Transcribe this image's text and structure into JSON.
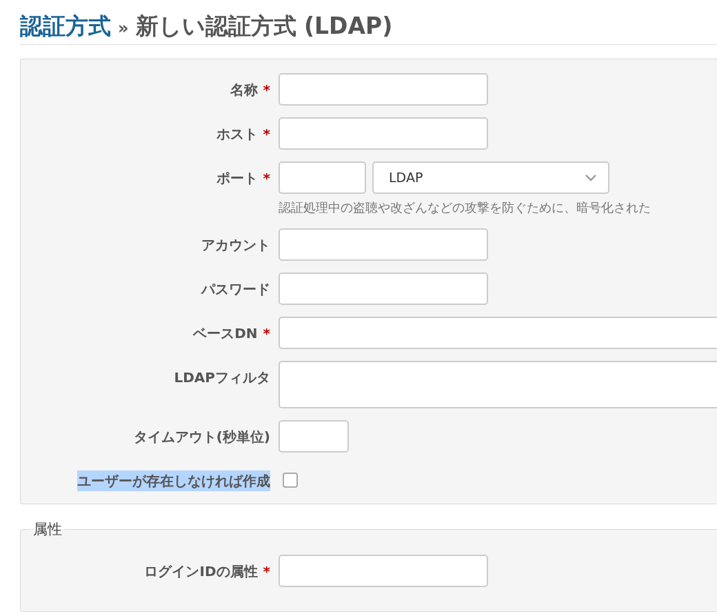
{
  "breadcrumb": {
    "parent": "認証方式",
    "separator": "»",
    "title": "新しい認証方式 (LDAP)"
  },
  "main_fields": [
    {
      "label": "名称",
      "required_mark": "*",
      "kind": "text",
      "highlighted": false
    },
    {
      "label": "ホスト",
      "required_mark": "*",
      "kind": "text",
      "highlighted": false
    },
    {
      "label": "ポート",
      "required_mark": "*",
      "kind": "port",
      "select_value": "LDAP",
      "hint": "認証処理中の盗聴や改ざんなどの攻撃を防ぐために、暗号化された",
      "highlighted": false
    },
    {
      "label": "アカウント",
      "kind": "text",
      "highlighted": false
    },
    {
      "label": "パスワード",
      "kind": "password",
      "highlighted": false
    },
    {
      "label": "ベースDN",
      "required_mark": "*",
      "kind": "wide",
      "highlighted": false
    },
    {
      "label": "LDAPフィルタ",
      "kind": "textarea",
      "highlighted": false
    },
    {
      "label": "タイムアウト(秒単位)",
      "kind": "short",
      "highlighted": false
    },
    {
      "label": "ユーザーが存在しなければ作成",
      "kind": "checkbox",
      "checked": false,
      "highlighted": true
    }
  ],
  "attributes": {
    "legend": "属性",
    "fields": [
      {
        "label": "ログインIDの属性",
        "required_mark": "*",
        "kind": "text",
        "highlighted": false
      }
    ]
  }
}
